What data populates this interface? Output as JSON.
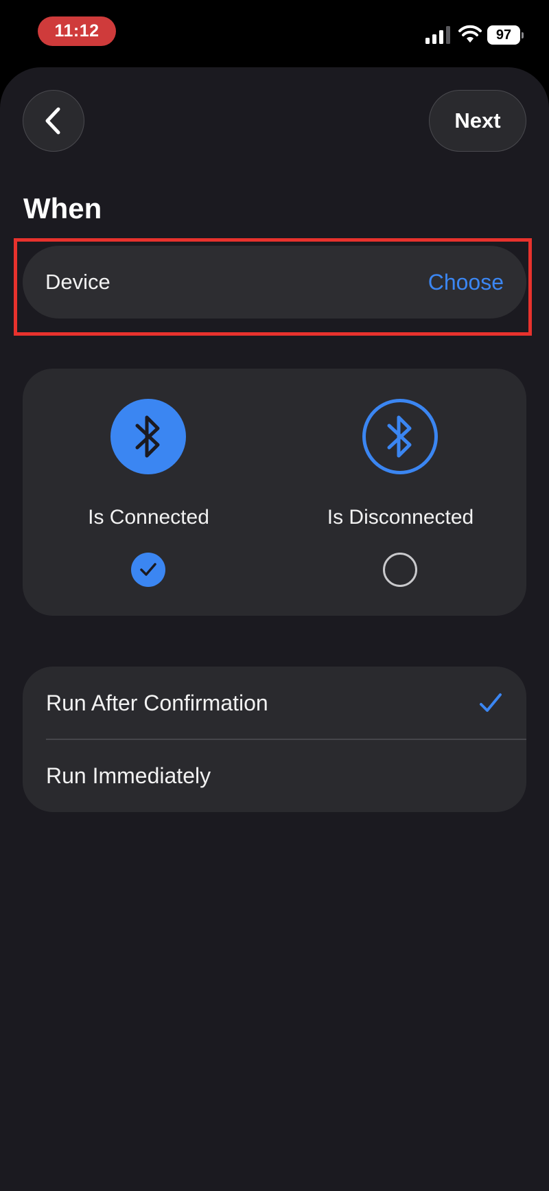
{
  "status_bar": {
    "time": "11:12",
    "battery": "97"
  },
  "header": {
    "next_label": "Next"
  },
  "section": {
    "title": "When"
  },
  "device_row": {
    "label": "Device",
    "action": "Choose"
  },
  "states": [
    {
      "label": "Is Connected",
      "selected": true,
      "icon": "bluetooth-filled-icon"
    },
    {
      "label": "Is Disconnected",
      "selected": false,
      "icon": "bluetooth-outline-icon"
    }
  ],
  "run_options": [
    {
      "label": "Run After Confirmation",
      "selected": true
    },
    {
      "label": "Run Immediately",
      "selected": false
    }
  ],
  "colors": {
    "accent": "#3b86f2",
    "highlight": "#e8322d",
    "sheet": "#1b1a20",
    "card": "#2a2a2e"
  }
}
